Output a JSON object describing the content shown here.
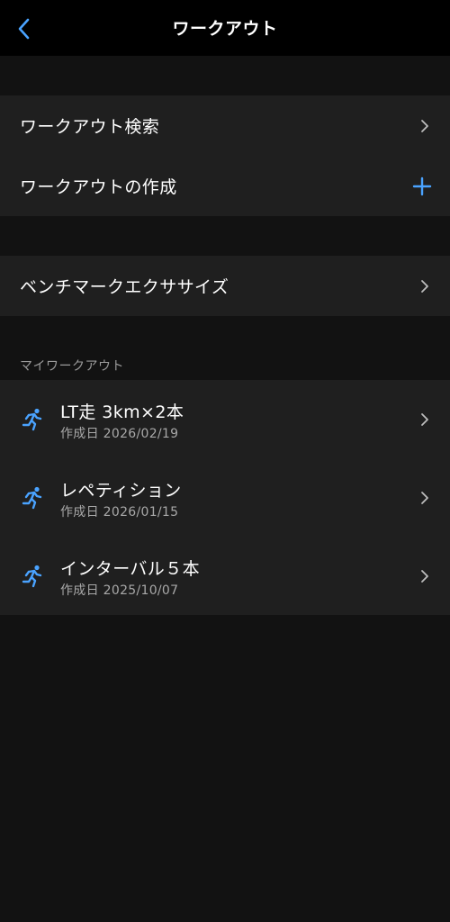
{
  "header": {
    "title": "ワークアウト",
    "back_icon": "chevron-left-icon",
    "accent_color": "#4aa3ff"
  },
  "group1": {
    "items": [
      {
        "label": "ワークアウト検索",
        "icon": "chevron-right-icon"
      },
      {
        "label": "ワークアウトの作成",
        "icon": "plus-icon"
      }
    ]
  },
  "group2": {
    "items": [
      {
        "label": "ベンチマークエクササイズ",
        "icon": "chevron-right-icon"
      }
    ]
  },
  "my_workouts": {
    "header": "マイワークアウト",
    "items": [
      {
        "title": "LT走 3km×2本",
        "date": "作成日 2026/02/19",
        "icon": "running-person-icon"
      },
      {
        "title": "レペティション",
        "date": "作成日 2026/01/15",
        "icon": "running-person-icon"
      },
      {
        "title": "インターバル５本",
        "date": "作成日 2025/10/07",
        "icon": "running-person-icon"
      }
    ]
  }
}
